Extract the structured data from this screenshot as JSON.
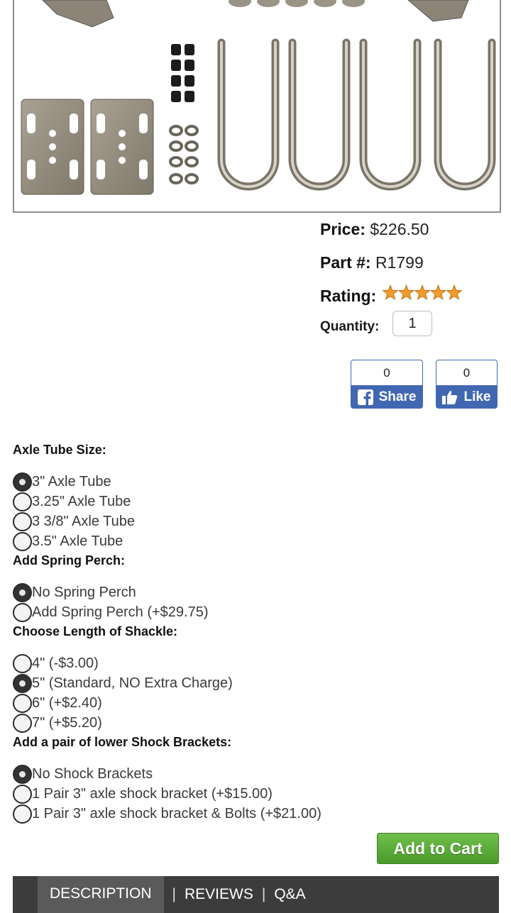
{
  "product": {
    "price_label": "Price:",
    "price": "$226.50",
    "part_label": "Part #:",
    "part": "R1799",
    "rating_label": "Rating:",
    "rating_stars": 5,
    "quantity_label": "Quantity:",
    "quantity": "1"
  },
  "social": {
    "share_count": "0",
    "share_label": "Share",
    "like_count": "0",
    "like_label": "Like",
    "color": "#4267b2"
  },
  "options": [
    {
      "title": "Axle Tube Size:",
      "choices": [
        {
          "label": "3\" Axle Tube",
          "checked": true
        },
        {
          "label": "3.25\" Axle Tube",
          "checked": false
        },
        {
          "label": "3 3/8\" Axle Tube",
          "checked": false
        },
        {
          "label": "3.5\" Axle Tube",
          "checked": false
        }
      ]
    },
    {
      "title": "Add Spring Perch:",
      "choices": [
        {
          "label": "No Spring Perch",
          "checked": true
        },
        {
          "label": "Add Spring Perch (+$29.75)",
          "checked": false
        }
      ]
    },
    {
      "title": "Choose Length of Shackle:",
      "choices": [
        {
          "label": "4\" (-$3.00)",
          "checked": false
        },
        {
          "label": "5\" (Standard, NO Extra Charge)",
          "checked": true
        },
        {
          "label": "6\" (+$2.40)",
          "checked": false
        },
        {
          "label": "7\" (+$5.20)",
          "checked": false
        }
      ]
    },
    {
      "title": "Add a pair of lower Shock Brackets:",
      "choices": [
        {
          "label": "No Shock Brackets",
          "checked": true
        },
        {
          "label": "1 Pair 3\" axle shock bracket (+$15.00)",
          "checked": false
        },
        {
          "label": "1 Pair 3\" axle shock bracket & Bolts (+$21.00)",
          "checked": false
        }
      ]
    }
  ],
  "cart": {
    "label": "Add to Cart",
    "color": "#5aad38"
  },
  "tabs": [
    {
      "label": "DESCRIPTION",
      "active": true
    },
    {
      "label": "REVIEWS",
      "active": false
    },
    {
      "label": "Q&A",
      "active": false
    }
  ],
  "tab_separator": "|"
}
